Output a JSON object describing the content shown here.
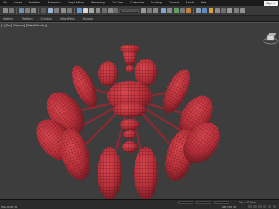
{
  "menu": [
    "File",
    "Create",
    "Modifiers",
    "Animation",
    "Graph Editors",
    "Rendering",
    "Civil View",
    "Customize",
    "Scripting",
    "Content",
    "Arnold",
    "Help"
  ],
  "signin_label": "Sign in",
  "toolbar": {
    "selection_set": "Create Selection Se"
  },
  "ribbon_tabs": [
    "Modeling",
    "Freeform",
    "Selection",
    "Object Paint",
    "Populate"
  ],
  "viewport": {
    "label": "[+] [Top] [Standard] [Default Shading]",
    "model_color": "#b8303a",
    "wire_color": "#5a0f16",
    "background": "#3d3d3d"
  },
  "status": {
    "script_label": "MAXScript Mi",
    "grid": "Grid = 10,0mm",
    "add_tag": "Add Time Tag"
  }
}
